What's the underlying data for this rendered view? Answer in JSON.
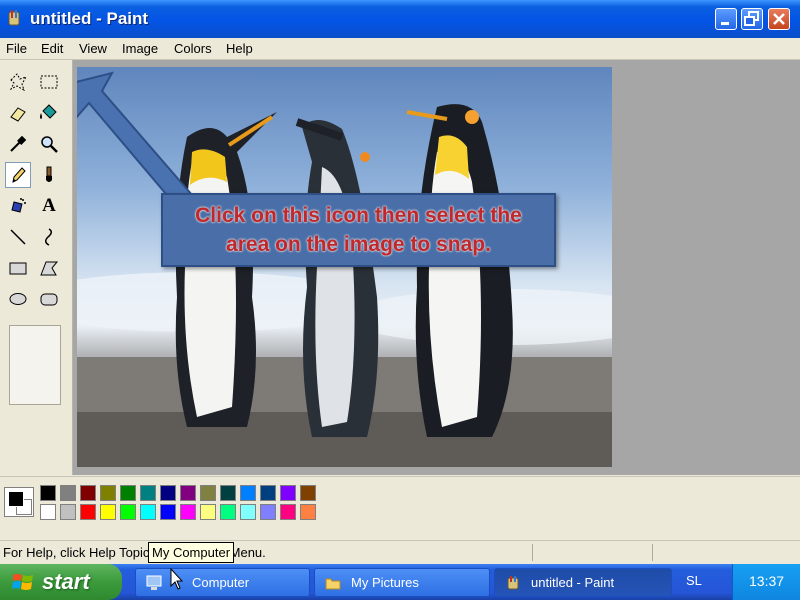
{
  "window": {
    "title": "untitled - Paint"
  },
  "menu": [
    "File",
    "Edit",
    "View",
    "Image",
    "Colors",
    "Help"
  ],
  "tools": [
    {
      "name": "free-form-select-icon"
    },
    {
      "name": "select-icon"
    },
    {
      "name": "eraser-icon"
    },
    {
      "name": "fill-bucket-icon"
    },
    {
      "name": "color-picker-icon"
    },
    {
      "name": "magnifier-icon"
    },
    {
      "name": "pencil-icon"
    },
    {
      "name": "brush-icon"
    },
    {
      "name": "airbrush-icon"
    },
    {
      "name": "text-icon"
    },
    {
      "name": "line-icon"
    },
    {
      "name": "curve-icon"
    },
    {
      "name": "rectangle-icon"
    },
    {
      "name": "polygon-icon"
    },
    {
      "name": "ellipse-icon"
    },
    {
      "name": "rounded-rectangle-icon"
    }
  ],
  "text_tool_glyph": "A",
  "callout": {
    "line1": "Click on this icon then select the",
    "line2": "area on the image to snap."
  },
  "palette": {
    "row1": [
      "#000000",
      "#808080",
      "#800000",
      "#808000",
      "#008000",
      "#008080",
      "#000080",
      "#800080",
      "#808040",
      "#004040",
      "#0080ff",
      "#004080",
      "#8000ff",
      "#804000"
    ],
    "row2": [
      "#ffffff",
      "#c0c0c0",
      "#ff0000",
      "#ffff00",
      "#00ff00",
      "#00ffff",
      "#0000ff",
      "#ff00ff",
      "#ffff80",
      "#00ff80",
      "#80ffff",
      "#8080ff",
      "#ff0080",
      "#ff8040"
    ]
  },
  "status": {
    "help_text": "For Help, click Help Topics on the Help Menu.",
    "tooltip": "My Computer"
  },
  "taskbar": {
    "start_label": "start",
    "tasks": [
      {
        "label": "Computer"
      },
      {
        "label": "My Pictures"
      },
      {
        "label": "untitled - Paint"
      }
    ],
    "language": "SL",
    "clock": "13:37"
  }
}
